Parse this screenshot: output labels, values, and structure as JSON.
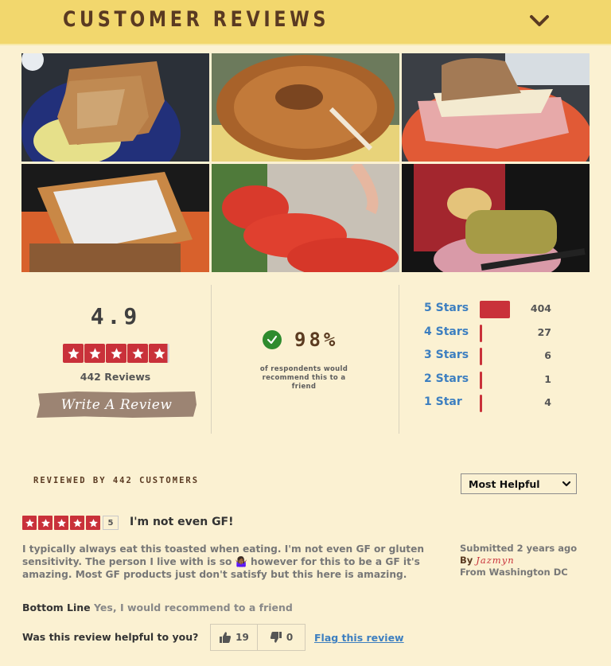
{
  "header": {
    "title": "CUSTOMER REVIEWS",
    "toggle_icon": "chevron-down-icon"
  },
  "photos": [
    {
      "alt": "Toast with scrambled eggs on blue plate"
    },
    {
      "alt": "Toasted bagel"
    },
    {
      "alt": "Ham and cheese sandwich on orange plate"
    },
    {
      "alt": "French toast with powdered sugar"
    },
    {
      "alt": "Tomato slices with lettuce"
    },
    {
      "alt": "Canyon Bakehouse bread bag with butter tub"
    }
  ],
  "summary": {
    "average_rating": "4.9",
    "rating_value": 4.9,
    "rating_max": 5,
    "review_count_label": "442 Reviews",
    "write_review_label": "Write A Review",
    "recommend_percent": "98%",
    "recommend_text": "of respondents would recommend this to a friend",
    "distribution": [
      {
        "label": "5 Stars",
        "count": "404",
        "value": 404
      },
      {
        "label": "4 Stars",
        "count": "27",
        "value": 27
      },
      {
        "label": "3 Stars",
        "count": "6",
        "value": 6
      },
      {
        "label": "2 Stars",
        "count": "1",
        "value": 1
      },
      {
        "label": "1 Star",
        "count": "4",
        "value": 4
      }
    ]
  },
  "reviews_section": {
    "reviewed_by": "REVIEWED BY 442 CUSTOMERS",
    "sort": {
      "selected": "Most Helpful"
    }
  },
  "reviews": [
    {
      "rating": 5,
      "rating_badge": "5",
      "title": "I'm not even GF!",
      "body": "I typically always eat this toasted when eating. I'm not even GF or gluten sensitivity. The person I live with is so 🤷🏾‍♀️ however for this to be a GF it's amazing. Most GF products just don't satisfy but this here is amazing.",
      "submitted": "Submitted 2 years ago",
      "by_label": "By",
      "author": "Jazmyn",
      "location": "From Washington DC",
      "bottom_line_label": "Bottom Line",
      "bottom_line_value": "Yes, I would recommend to a friend",
      "helpful_question": "Was this review helpful to you?",
      "helpful_yes": "19",
      "helpful_no": "0",
      "flag_label": "Flag this review"
    }
  ],
  "colors": {
    "background": "#fbf1d2",
    "header": "#f2d76d",
    "brand_brown": "#5a3a22",
    "star_red": "#c9313a",
    "link_blue": "#3d7fc0",
    "check_green": "#2e8b2e",
    "button_taupe": "#9c8473"
  }
}
